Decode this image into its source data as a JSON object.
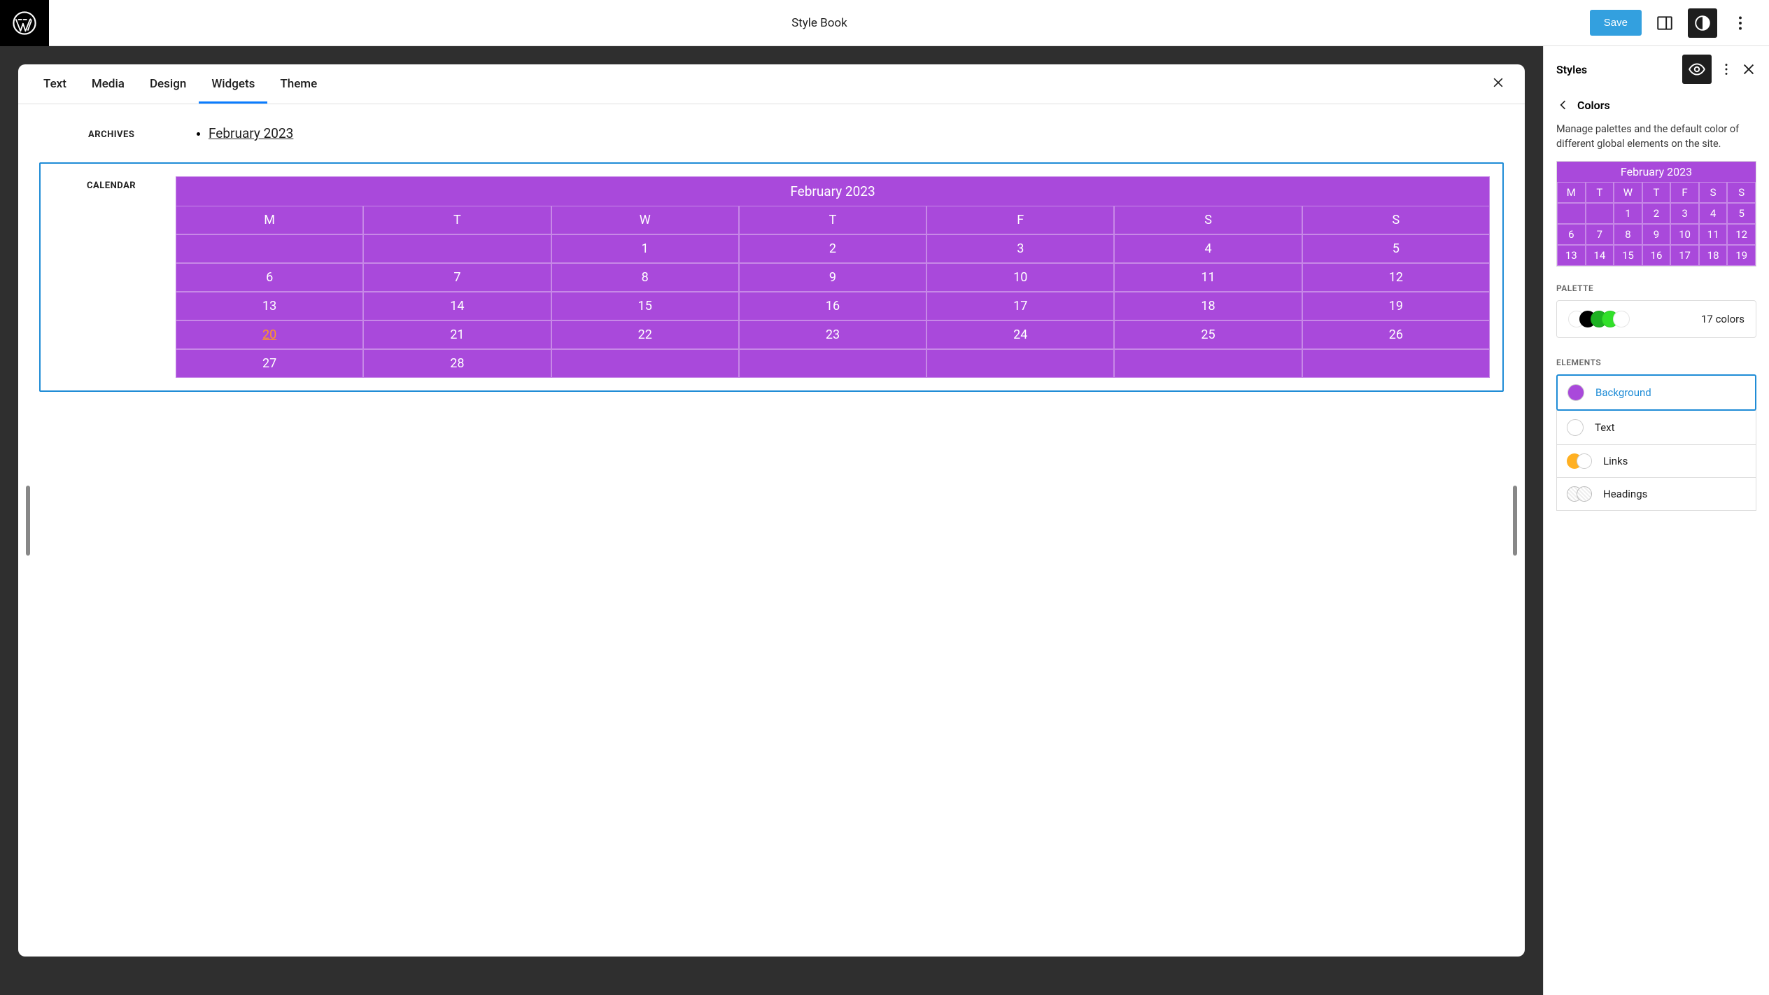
{
  "header": {
    "title": "Style Book",
    "save": "Save"
  },
  "tabs": [
    "Text",
    "Media",
    "Design",
    "Widgets",
    "Theme"
  ],
  "active_tab": 3,
  "archives": {
    "label": "ARCHIVES",
    "items": [
      "February 2023"
    ]
  },
  "calendar": {
    "label": "CALENDAR",
    "caption": "February 2023",
    "days": [
      "M",
      "T",
      "W",
      "T",
      "F",
      "S",
      "S"
    ],
    "weeks": [
      [
        "",
        "",
        "1",
        "2",
        "3",
        "4",
        "5"
      ],
      [
        "6",
        "7",
        "8",
        "9",
        "10",
        "11",
        "12"
      ],
      [
        "13",
        "14",
        "15",
        "16",
        "17",
        "18",
        "19"
      ],
      [
        "20",
        "21",
        "22",
        "23",
        "24",
        "25",
        "26"
      ],
      [
        "27",
        "28",
        "",
        "",
        "",
        "",
        ""
      ]
    ],
    "linked_day": "20"
  },
  "sidebar": {
    "title": "Styles",
    "crumb": "Colors",
    "desc": "Manage palettes and the default color of different global elements on the site.",
    "preview": {
      "caption": "February 2023",
      "days": [
        "M",
        "T",
        "W",
        "T",
        "F",
        "S",
        "S"
      ],
      "weeks": [
        [
          "",
          "",
          "1",
          "2",
          "3",
          "4",
          "5"
        ],
        [
          "6",
          "7",
          "8",
          "9",
          "10",
          "11",
          "12"
        ],
        [
          "13",
          "14",
          "15",
          "16",
          "17",
          "18",
          "19"
        ]
      ]
    },
    "palette": {
      "label": "PALETTE",
      "count": "17 colors",
      "swatches": [
        "#ffffff",
        "#000000",
        "#1db122",
        "#32e02a",
        "#ffffff"
      ]
    },
    "elements": {
      "label": "ELEMENTS",
      "items": [
        {
          "name": "Background",
          "color": "#a949db",
          "selected": true,
          "type": "single"
        },
        {
          "name": "Text",
          "color": "#ffffff",
          "selected": false,
          "type": "single"
        },
        {
          "name": "Links",
          "type": "links",
          "selected": false
        },
        {
          "name": "Headings",
          "type": "headings",
          "selected": false
        }
      ]
    }
  }
}
